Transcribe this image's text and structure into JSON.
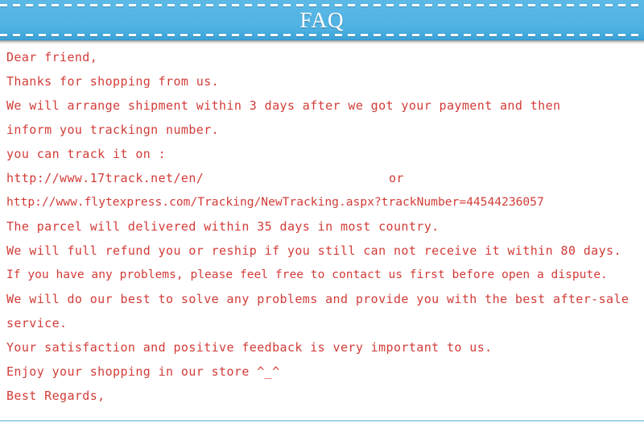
{
  "header": {
    "title": "FAQ",
    "background_color": "#55b5e4",
    "title_color": "#ffffff",
    "stitch_color": "#ffffff"
  },
  "body": {
    "text_color": "#d23c38",
    "lines": [
      {
        "id": "greeting",
        "text": "Dear friend,"
      },
      {
        "id": "thanks",
        "text": "Thanks for shopping from us."
      },
      {
        "id": "shipping-time",
        "text": "We will arrange shipment within 3 days after we got your payment and then"
      },
      {
        "id": "inform",
        "text": "inform you trackingn number."
      },
      {
        "id": "track-intro",
        "text": "you can track it on :"
      },
      {
        "id": "track-url-1",
        "text": "http://www.17track.net/en/",
        "trailing": "or"
      },
      {
        "id": "track-url-2",
        "text": "http://www.flytexpress.com/Tracking/NewTracking.aspx?trackNumber=44544236057",
        "tight": true
      },
      {
        "id": "delivery-time",
        "text": "The parcel will delivered within 35 days in most country."
      },
      {
        "id": "refund-policy",
        "text": "We will full refund you or reship if you still can not receive it within 80 days."
      },
      {
        "id": "dispute-note",
        "text": "If you have any problems, please feel free to contact us first before open a dispute.",
        "tight": true
      },
      {
        "id": "support-1",
        "text": "We will do our best to solve any problems and provide you with the best after-sale"
      },
      {
        "id": "support-2",
        "text": "service."
      },
      {
        "id": "feedback",
        "text": "Your satisfaction and positive feedback is very important to us."
      },
      {
        "id": "enjoy",
        "text": "Enjoy your shopping in our store ^_^"
      },
      {
        "id": "signoff",
        "text": "Best Regards,"
      }
    ]
  },
  "footer": {
    "rule_color": "#9fd4ee"
  }
}
